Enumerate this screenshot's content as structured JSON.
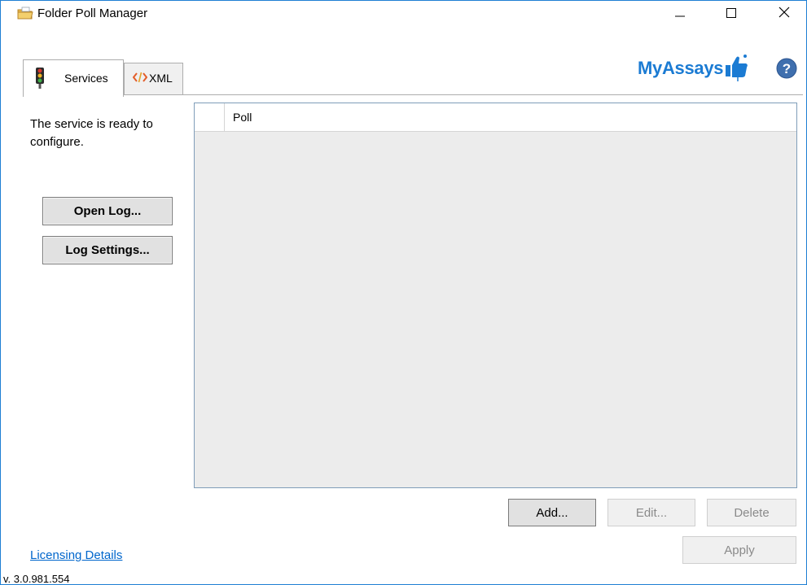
{
  "window": {
    "title": "Folder Poll Manager",
    "icons": {
      "app": "folder-poll-icon",
      "minimize": "minimize-icon",
      "maximize": "maximize-icon",
      "close": "close-icon"
    }
  },
  "tabs": [
    {
      "label": "Services",
      "icon": "traffic-light-icon",
      "selected": true
    },
    {
      "label": "XML",
      "icon": "code-tag-icon",
      "selected": false
    }
  ],
  "brand": {
    "text": "MyAssays",
    "icon": "thumbs-up-icon",
    "color": "#1b7bd3"
  },
  "help": {
    "icon": "help-icon"
  },
  "left_pane": {
    "status": "The service is ready to configure.",
    "open_log_label": "Open Log...",
    "log_settings_label": "Log Settings..."
  },
  "grid": {
    "columns": [
      "Poll"
    ],
    "rows": []
  },
  "actions": {
    "add_label": "Add...",
    "edit_label": "Edit...",
    "delete_label": "Delete",
    "apply_label": "Apply"
  },
  "footer": {
    "licensing_link": "Licensing Details",
    "version": "v. 3.0.981.554"
  }
}
